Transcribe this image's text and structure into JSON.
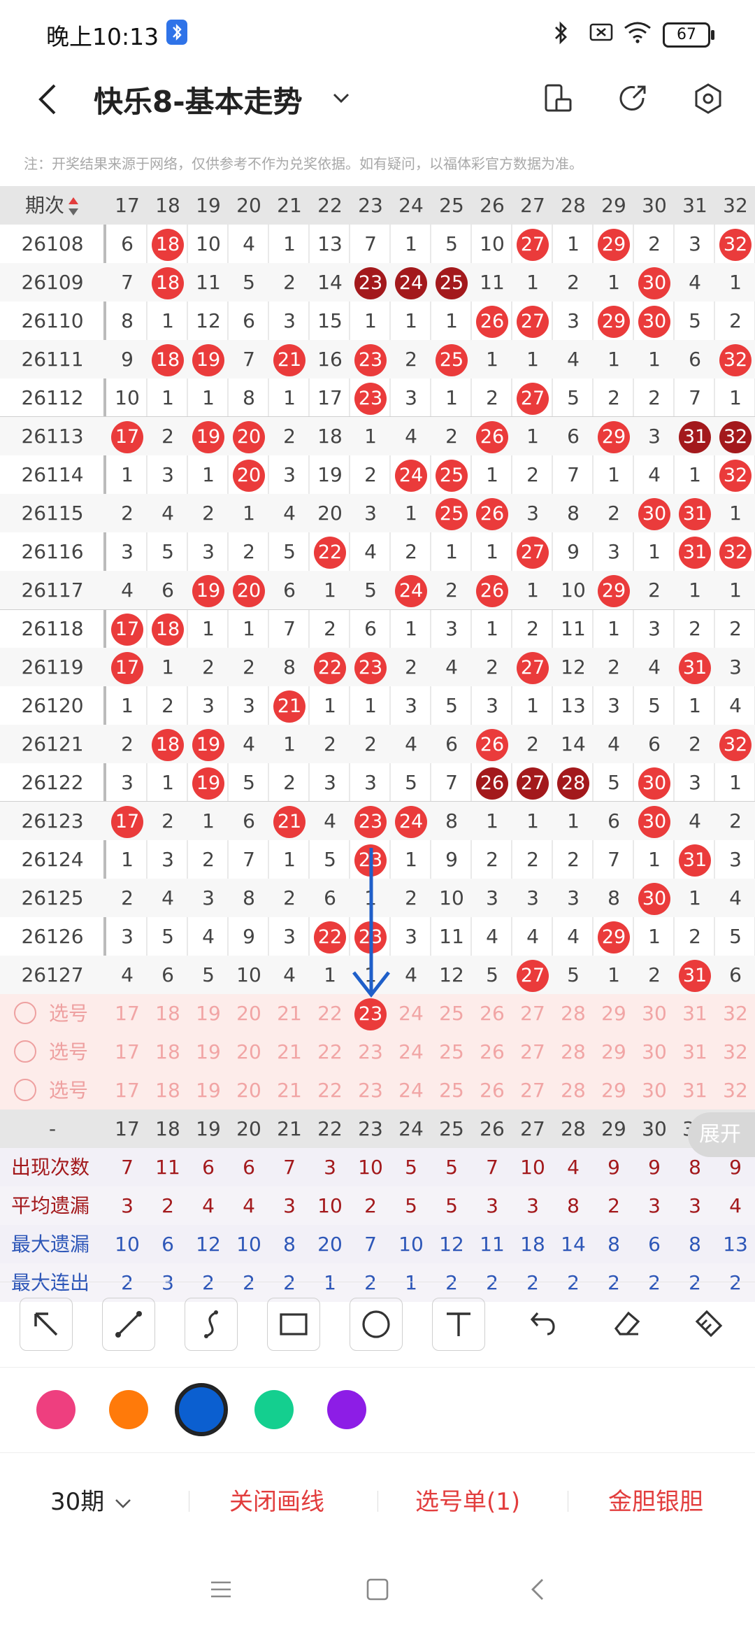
{
  "status": {
    "time": "晚上10:13",
    "battery": "67"
  },
  "header": {
    "title": "快乐8-基本走势"
  },
  "notice": "注：开奖结果来源于网络，仅供参考不作为兑奖依据。如有疑问，以福体彩官方数据为准。",
  "table": {
    "period_header": "期次",
    "columns": [
      "17",
      "18",
      "19",
      "20",
      "21",
      "22",
      "23",
      "24",
      "25",
      "26",
      "27",
      "28",
      "29",
      "30",
      "31",
      "32"
    ],
    "rows": [
      {
        "period": "26108",
        "cells": [
          "6",
          "18",
          "10",
          "4",
          "1",
          "13",
          "7",
          "1",
          "5",
          "10",
          "27",
          "1",
          "29",
          "2",
          "3",
          "32"
        ],
        "types": [
          "",
          "r",
          "",
          "",
          "",
          "",
          "",
          "",
          "",
          "",
          "r",
          "",
          "r",
          "",
          "",
          "r"
        ]
      },
      {
        "period": "26109",
        "cells": [
          "7",
          "18",
          "11",
          "5",
          "2",
          "14",
          "23",
          "24",
          "25",
          "11",
          "1",
          "2",
          "1",
          "30",
          "4",
          "1"
        ],
        "types": [
          "",
          "r",
          "",
          "",
          "",
          "",
          "d",
          "d",
          "d",
          "",
          "",
          "",
          "",
          "r",
          "",
          ""
        ]
      },
      {
        "period": "26110",
        "cells": [
          "8",
          "1",
          "12",
          "6",
          "3",
          "15",
          "1",
          "1",
          "1",
          "26",
          "27",
          "3",
          "29",
          "30",
          "5",
          "2"
        ],
        "types": [
          "",
          "",
          "",
          "",
          "",
          "",
          "",
          "",
          "",
          "r",
          "r",
          "",
          "r",
          "r",
          "",
          ""
        ]
      },
      {
        "period": "26111",
        "cells": [
          "9",
          "18",
          "19",
          "7",
          "21",
          "16",
          "23",
          "2",
          "25",
          "1",
          "1",
          "4",
          "1",
          "1",
          "6",
          "32"
        ],
        "types": [
          "",
          "r",
          "r",
          "",
          "r",
          "",
          "r",
          "",
          "r",
          "",
          "",
          "",
          "",
          "",
          "",
          "r"
        ]
      },
      {
        "period": "26112",
        "cells": [
          "10",
          "1",
          "1",
          "8",
          "1",
          "17",
          "23",
          "3",
          "1",
          "2",
          "27",
          "5",
          "2",
          "2",
          "7",
          "1"
        ],
        "types": [
          "",
          "",
          "",
          "",
          "",
          "",
          "r",
          "",
          "",
          "",
          "r",
          "",
          "",
          "",
          "",
          ""
        ]
      },
      {
        "period": "26113",
        "cells": [
          "17",
          "2",
          "19",
          "20",
          "2",
          "18",
          "1",
          "4",
          "2",
          "26",
          "1",
          "6",
          "29",
          "3",
          "31",
          "32"
        ],
        "types": [
          "r",
          "",
          "r",
          "r",
          "",
          "",
          "",
          "",
          "",
          "r",
          "",
          "",
          "r",
          "",
          "d",
          "d"
        ]
      },
      {
        "period": "26114",
        "cells": [
          "1",
          "3",
          "1",
          "20",
          "3",
          "19",
          "2",
          "24",
          "25",
          "1",
          "2",
          "7",
          "1",
          "4",
          "1",
          "32"
        ],
        "types": [
          "",
          "",
          "",
          "r",
          "",
          "",
          "",
          "r",
          "r",
          "",
          "",
          "",
          "",
          "",
          "",
          "r"
        ]
      },
      {
        "period": "26115",
        "cells": [
          "2",
          "4",
          "2",
          "1",
          "4",
          "20",
          "3",
          "1",
          "25",
          "26",
          "3",
          "8",
          "2",
          "30",
          "31",
          "1"
        ],
        "types": [
          "",
          "",
          "",
          "",
          "",
          "",
          "",
          "",
          "r",
          "r",
          "",
          "",
          "",
          "r",
          "r",
          ""
        ]
      },
      {
        "period": "26116",
        "cells": [
          "3",
          "5",
          "3",
          "2",
          "5",
          "22",
          "4",
          "2",
          "1",
          "1",
          "27",
          "9",
          "3",
          "1",
          "31",
          "32"
        ],
        "types": [
          "",
          "",
          "",
          "",
          "",
          "r",
          "",
          "",
          "",
          "",
          "r",
          "",
          "",
          "",
          "r",
          "r"
        ]
      },
      {
        "period": "26117",
        "cells": [
          "4",
          "6",
          "19",
          "20",
          "6",
          "1",
          "5",
          "24",
          "2",
          "26",
          "1",
          "10",
          "29",
          "2",
          "1",
          "1"
        ],
        "types": [
          "",
          "",
          "r",
          "r",
          "",
          "",
          "",
          "r",
          "",
          "r",
          "",
          "",
          "r",
          "",
          "",
          ""
        ]
      },
      {
        "period": "26118",
        "cells": [
          "17",
          "18",
          "1",
          "1",
          "7",
          "2",
          "6",
          "1",
          "3",
          "1",
          "2",
          "11",
          "1",
          "3",
          "2",
          "2"
        ],
        "types": [
          "r",
          "r",
          "",
          "",
          "",
          "",
          "",
          "",
          "",
          "",
          "",
          "",
          "",
          "",
          "",
          ""
        ]
      },
      {
        "period": "26119",
        "cells": [
          "17",
          "1",
          "2",
          "2",
          "8",
          "22",
          "23",
          "2",
          "4",
          "2",
          "27",
          "12",
          "2",
          "4",
          "31",
          "3"
        ],
        "types": [
          "r",
          "",
          "",
          "",
          "",
          "r",
          "r",
          "",
          "",
          "",
          "r",
          "",
          "",
          "",
          "r",
          ""
        ]
      },
      {
        "period": "26120",
        "cells": [
          "1",
          "2",
          "3",
          "3",
          "21",
          "1",
          "1",
          "3",
          "5",
          "3",
          "1",
          "13",
          "3",
          "5",
          "1",
          "4"
        ],
        "types": [
          "",
          "",
          "",
          "",
          "r",
          "",
          "",
          "",
          "",
          "",
          "",
          "",
          "",
          "",
          "",
          ""
        ]
      },
      {
        "period": "26121",
        "cells": [
          "2",
          "18",
          "19",
          "4",
          "1",
          "2",
          "2",
          "4",
          "6",
          "26",
          "2",
          "14",
          "4",
          "6",
          "2",
          "32"
        ],
        "types": [
          "",
          "r",
          "r",
          "",
          "",
          "",
          "",
          "",
          "",
          "r",
          "",
          "",
          "",
          "",
          "",
          "r"
        ]
      },
      {
        "period": "26122",
        "cells": [
          "3",
          "1",
          "19",
          "5",
          "2",
          "3",
          "3",
          "5",
          "7",
          "26",
          "27",
          "28",
          "5",
          "30",
          "3",
          "1"
        ],
        "types": [
          "",
          "",
          "r",
          "",
          "",
          "",
          "",
          "",
          "",
          "d",
          "d",
          "d",
          "",
          "r",
          "",
          ""
        ]
      },
      {
        "period": "26123",
        "cells": [
          "17",
          "2",
          "1",
          "6",
          "21",
          "4",
          "23",
          "24",
          "8",
          "1",
          "1",
          "1",
          "6",
          "30",
          "4",
          "2"
        ],
        "types": [
          "r",
          "",
          "",
          "",
          "r",
          "",
          "r",
          "r",
          "",
          "",
          "",
          "",
          "",
          "r",
          "",
          ""
        ]
      },
      {
        "period": "26124",
        "cells": [
          "1",
          "3",
          "2",
          "7",
          "1",
          "5",
          "23",
          "1",
          "9",
          "2",
          "2",
          "2",
          "7",
          "1",
          "31",
          "3"
        ],
        "types": [
          "",
          "",
          "",
          "",
          "",
          "",
          "r",
          "",
          "",
          "",
          "",
          "",
          "",
          "",
          "r",
          ""
        ]
      },
      {
        "period": "26125",
        "cells": [
          "2",
          "4",
          "3",
          "8",
          "2",
          "6",
          "1",
          "2",
          "10",
          "3",
          "3",
          "3",
          "8",
          "30",
          "1",
          "4"
        ],
        "types": [
          "",
          "",
          "",
          "",
          "",
          "",
          "",
          "",
          "",
          "",
          "",
          "",
          "",
          "r",
          "",
          ""
        ]
      },
      {
        "period": "26126",
        "cells": [
          "3",
          "5",
          "4",
          "9",
          "3",
          "22",
          "23",
          "3",
          "11",
          "4",
          "4",
          "4",
          "29",
          "1",
          "2",
          "5"
        ],
        "types": [
          "",
          "",
          "",
          "",
          "",
          "r",
          "r",
          "",
          "",
          "",
          "",
          "",
          "r",
          "",
          "",
          ""
        ]
      },
      {
        "period": "26127",
        "cells": [
          "4",
          "6",
          "5",
          "10",
          "4",
          "1",
          "1",
          "4",
          "12",
          "5",
          "27",
          "5",
          "1",
          "2",
          "31",
          "6"
        ],
        "types": [
          "",
          "",
          "",
          "",
          "",
          "",
          "",
          "",
          "",
          "",
          "r",
          "",
          "",
          "",
          "r",
          ""
        ]
      }
    ],
    "select_label": "选号",
    "select_rows": [
      {
        "highlight": "23"
      },
      {
        "highlight": ""
      },
      {
        "highlight": ""
      }
    ],
    "footer_period": "-",
    "stats": [
      {
        "label": "出现次数",
        "color": "#a3191c",
        "values": [
          "7",
          "11",
          "6",
          "6",
          "7",
          "3",
          "10",
          "5",
          "5",
          "7",
          "10",
          "4",
          "9",
          "9",
          "8",
          "9"
        ]
      },
      {
        "label": "平均遗漏",
        "color": "#a3191c",
        "values": [
          "3",
          "2",
          "4",
          "4",
          "3",
          "10",
          "2",
          "5",
          "5",
          "3",
          "3",
          "8",
          "2",
          "3",
          "3",
          "4"
        ]
      },
      {
        "label": "最大遗漏",
        "color": "#2e57b8",
        "values": [
          "10",
          "6",
          "12",
          "10",
          "8",
          "20",
          "7",
          "10",
          "12",
          "11",
          "18",
          "14",
          "8",
          "6",
          "8",
          "13"
        ]
      },
      {
        "label": "最大连出",
        "color": "#2e57b8",
        "values": [
          "2",
          "3",
          "2",
          "2",
          "2",
          "1",
          "2",
          "1",
          "2",
          "2",
          "2",
          "2",
          "2",
          "2",
          "2",
          "2"
        ]
      }
    ]
  },
  "expand_label": "展开",
  "tools": [
    "arrow-tool",
    "line-tool",
    "curve-tool",
    "rect-tool",
    "circle-tool",
    "text-tool",
    "undo-tool",
    "eraser-tool",
    "clear-tool"
  ],
  "palette": [
    "#ee3f7f",
    "#ff7a0a",
    "#0b5fd0",
    "#14cf8f",
    "#8d1de6"
  ],
  "selected_color": "#0b5fd0",
  "bottom": {
    "period_select": "30期",
    "close_draw": "关闭画线",
    "pick_list": "选号单(1)",
    "golden": "金胆银胆"
  },
  "colors": {
    "ball_red": "#ea3b3b",
    "ball_dark": "#a3191c",
    "accent": "#e23d3d",
    "arrow": "#1f5fc9"
  }
}
